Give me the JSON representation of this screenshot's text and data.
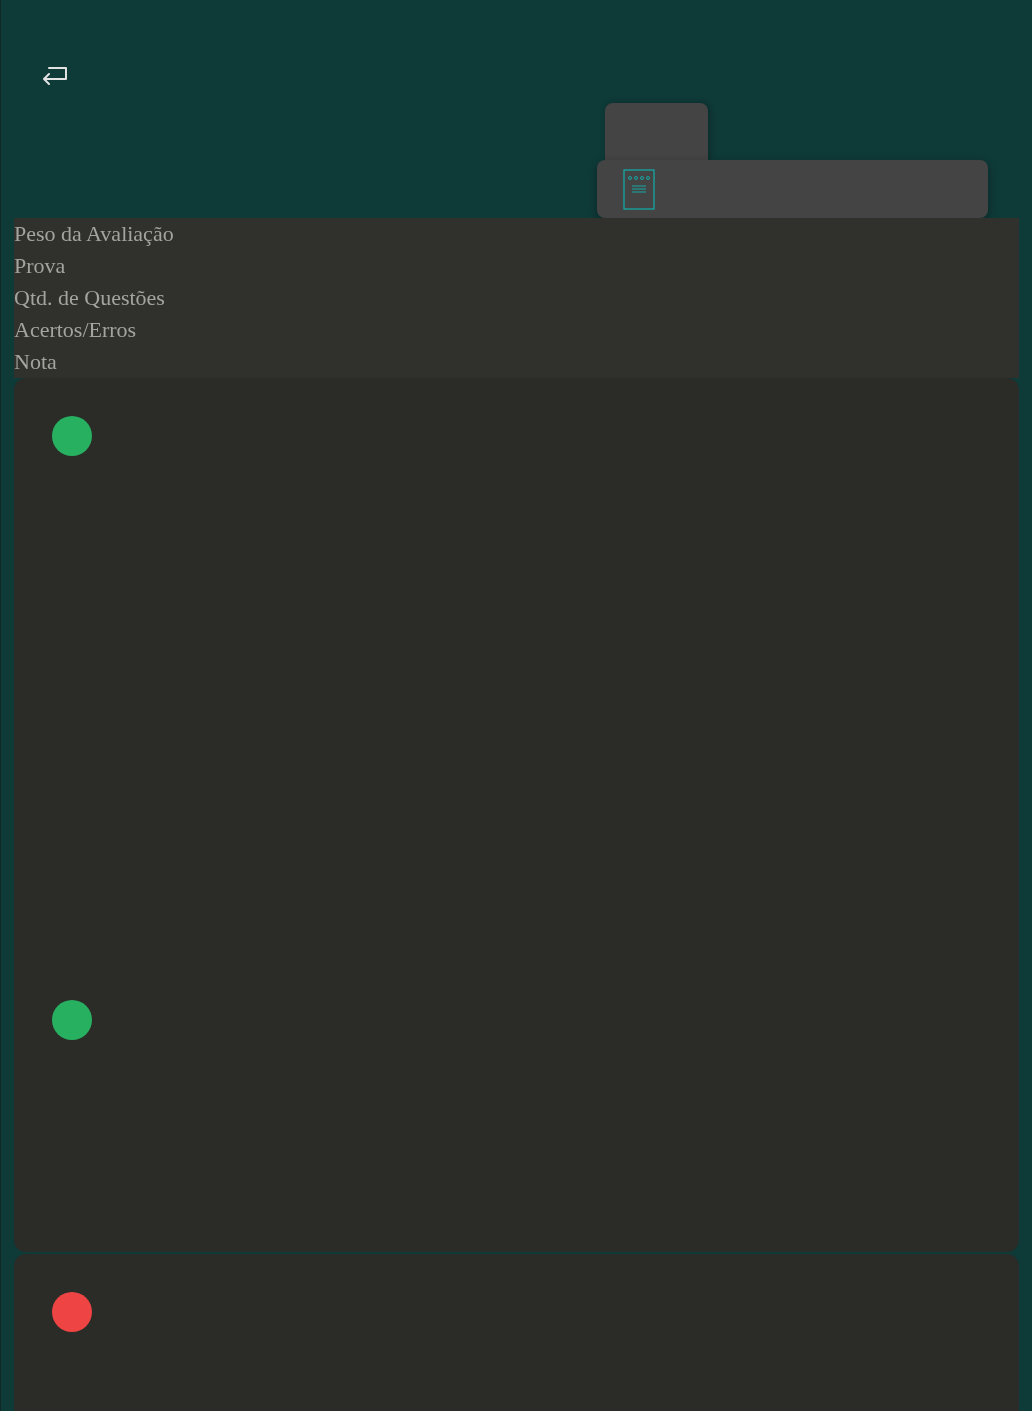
{
  "header": {
    "labels": [
      "Peso da Avaliação",
      "Prova",
      "Qtd. de Questões",
      "Acertos/Erros",
      "Nota"
    ]
  },
  "cards": [
    {
      "dots": [
        {
          "color": "#27b060"
        },
        {
          "color": "#27b060"
        }
      ]
    },
    {
      "dots": [
        {
          "color": "#ef4444"
        }
      ]
    }
  ]
}
